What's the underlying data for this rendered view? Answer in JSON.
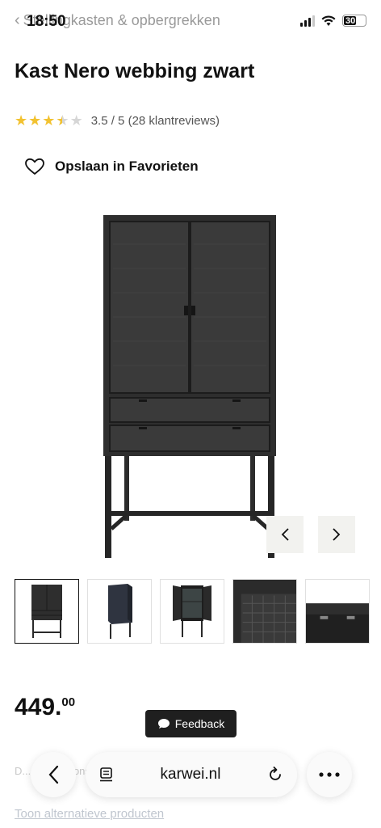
{
  "status": {
    "time": "18:50",
    "battery": "30"
  },
  "breadcrumb": {
    "label": "Stellingkasten & opbergrekken"
  },
  "product": {
    "title": "Kast Nero webbing zwart",
    "rating_value": 3.5,
    "rating_max": 5,
    "rating_text": "3.5 / 5 (28 klantreviews)",
    "favorite_label": "Opslaan in Favorieten",
    "price_main": "449.",
    "price_cents": "00"
  },
  "gallery": {
    "thumbnails": [
      "front",
      "angle",
      "open",
      "detail",
      "drawer"
    ],
    "active_index": 0
  },
  "feedback": {
    "label": "Feedback"
  },
  "behind_bar": {
    "partial_text": "D... ...c... ...l ons..."
  },
  "links": {
    "alternatives": "Toon alternatieve producten"
  },
  "browser": {
    "url": "karwei.nl"
  },
  "colors": {
    "star": "#f2c230",
    "cabinet": "#2b2b2b",
    "nav_button_bg": "#f2f2ef",
    "feedback_bg": "#1f1f1f"
  },
  "icons": {
    "back": "chevron-left-icon",
    "favorite": "heart-outline-icon",
    "prev": "chevron-left-icon",
    "next": "chevron-right-icon",
    "feedback": "chat-bubble-icon",
    "reader": "reader-mode-icon",
    "reload": "reload-icon",
    "more": "ellipsis-icon"
  }
}
